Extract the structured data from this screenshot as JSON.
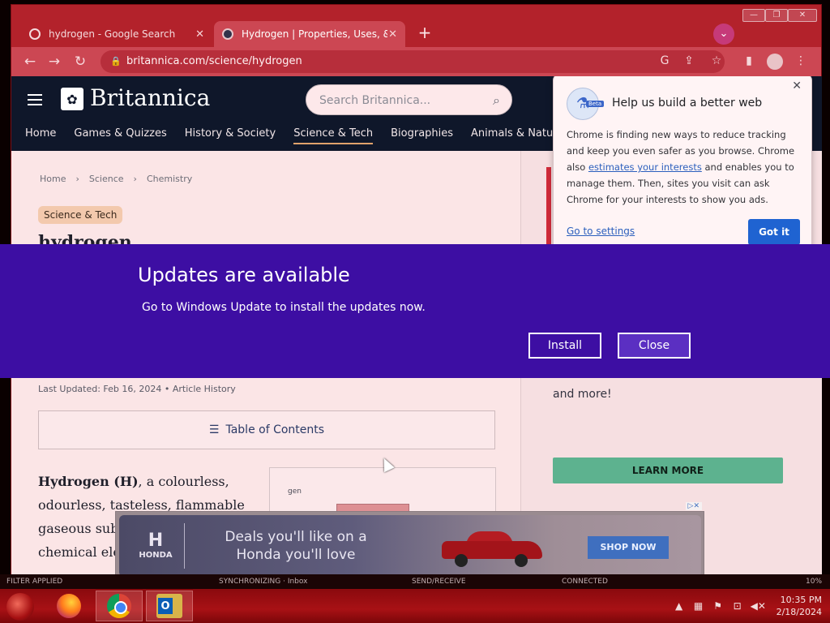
{
  "browser": {
    "tabs": [
      {
        "label": "hydrogen - Google Search",
        "active": false
      },
      {
        "label": "Hydrogen | Properties, Uses, & F",
        "active": true
      }
    ],
    "url": "britannica.com/science/hydrogen"
  },
  "site": {
    "logo": "Britannica",
    "search_placeholder": "Search Britannica...",
    "nav": [
      "Home",
      "Games & Quizzes",
      "History & Society",
      "Science & Tech",
      "Biographies",
      "Animals & Nature"
    ],
    "nav_current": "Science & Tech",
    "breadcrumbs": [
      "Home",
      "Science",
      "Chemistry"
    ],
    "badge": "Science & Tech",
    "title": "hydrogen",
    "updated": "Last Updated: Feb 16, 2024 • Article History",
    "toc_label": "Table of Contents",
    "article_lead": "Hydrogen (H)",
    "article_text": ", a colourless, odourless, tasteless, flammable gaseous sub simplest me chemical ele",
    "figure_caption": "gen",
    "sidebar_more": "and more!",
    "learn_more": "LEARN MORE"
  },
  "privacy_popup": {
    "title": "Help us build a better web",
    "badge": "Beta",
    "body_before": "Chrome is finding new ways to reduce tracking and keep you even safer as you browse. Chrome also ",
    "body_link": "estimates your interests",
    "body_after": " and enables you to manage them. Then, sites you visit can ask Chrome for your interests to show you ads.",
    "settings_link": "Go to settings",
    "confirm": "Got it"
  },
  "ad": {
    "brand": "HONDA",
    "text_line1": "Deals you'll like on a",
    "text_line2": "Honda you'll love",
    "cta": "SHOP NOW"
  },
  "windows_update": {
    "title": "Updates are available",
    "message": "Go to Windows Update to install the updates now.",
    "install": "Install",
    "close": "Close"
  },
  "status_strip": {
    "left": "FILTER APPLIED",
    "sync": "SYNCHRONIZING · Inbox",
    "send": "SEND/RECEIVE",
    "connected": "CONNECTED",
    "zoom": "10%"
  },
  "taskbar": {
    "time": "10:35 PM",
    "date": "2/18/2024"
  },
  "colors": {
    "update_bg": "#3d0ea3",
    "window_frame": "#b3222b",
    "header_bg": "#0f172a"
  }
}
